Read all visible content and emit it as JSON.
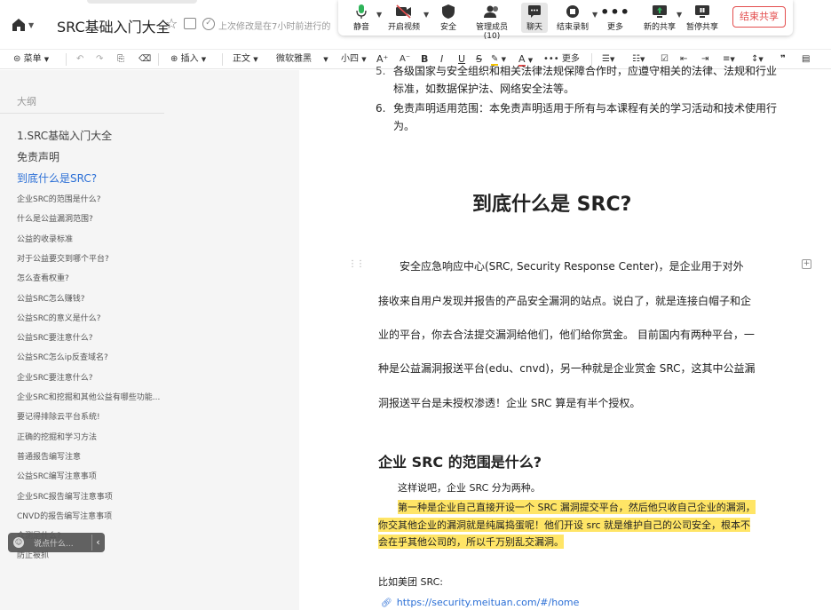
{
  "header": {
    "title": "SRC基础入门大全",
    "status": "上次修改是在7小时前进行的"
  },
  "meeting": {
    "mute": "静音",
    "video": "开启视频",
    "security": "安全",
    "members": "管理成员(10)",
    "chat": "聊天",
    "record": "结束录制",
    "more": "更多",
    "new_share": "新的共享",
    "pause_share": "暂停共享",
    "end_share": "结束共享"
  },
  "toolbar": {
    "menu": "菜单",
    "insert": "插入",
    "style": "正文",
    "font": "微软雅黑",
    "size": "小四",
    "more": "更多"
  },
  "sidebar": {
    "heading": "大纲",
    "items": [
      {
        "label": "1.SRC基础入门大全"
      },
      {
        "label": "免责声明"
      },
      {
        "label": "到底什么是SRC?"
      },
      {
        "label": "企业SRC的范围是什么?"
      },
      {
        "label": "什么是公益漏洞范围?"
      },
      {
        "label": "公益的收录标准"
      },
      {
        "label": "对于公益要交到哪个平台?"
      },
      {
        "label": "怎么查看权重?"
      },
      {
        "label": "公益SRC怎么赚钱?"
      },
      {
        "label": "公益SRC的意义是什么?"
      },
      {
        "label": "公益SRC要注意什么?"
      },
      {
        "label": "公益SRC怎么ip反查域名?"
      },
      {
        "label": "企业SRC要注意什么?"
      },
      {
        "label": "企业SRC和挖掘和其他公益有哪些功能..."
      },
      {
        "label": "要记得排除云平台系统!"
      },
      {
        "label": "正确的挖掘和学习方法"
      },
      {
        "label": "普通报告编写注意"
      },
      {
        "label": "公益SRC编写注意事项"
      },
      {
        "label": "企业SRC报告编写注意事项"
      },
      {
        "label": "CNVD的报告编写注意事项"
      },
      {
        "label": "众测是什么?"
      },
      {
        "label": "防止被抓"
      }
    ]
  },
  "chat_toast": {
    "placeholder": "说点什么..."
  },
  "document": {
    "item5": "各级国家与安全组织和相关法律法规保障合作时，应遵守相关的法律、法规和行业标准，如数据保护法、网络安全法等。",
    "item5_line1": "各级国家与安全组织和相关法律法规保障合作时，应遵守相关的法律、法规和行业",
    "item5_line2": "标准，如数据保护法、网络安全法等。",
    "item6_num": "6.",
    "item6_line1": "免责声明适用范围：本免责声明适用于所有与本课程有关的学习活动和技术使用行",
    "item6_line2": "为。",
    "heading1": "到底什么是 SRC?",
    "para_lines": [
      "安全应急响应中心(SRC, Security Response Center)，是企业用于对外",
      "接收来自用户发现并报告的产品安全漏洞的站点。说白了，就是连接白帽子和企",
      "业的平台，你去合法提交漏洞给他们，他们给你赏金。 目前国内有两种平台，一",
      "种是公益漏洞报送平台(edu、cnvd)，另一种就是企业赏金 SRC，这其中公益漏",
      "洞报送平台是未授权渗透！企业 SRC 算是有半个授权。"
    ],
    "heading2": "企业 SRC 的范围是什么?",
    "intro": "这样说吧，企业 SRC 分为两种。",
    "highlight_lines": [
      "第一种是企业自己直接开设一个 SRC 漏洞提交平台，然后他只收自己企业的漏洞，",
      "你交其他企业的漏洞就是纯属捣蛋呢！他们开设 src 就是维护自己的公司安全，根本不",
      "会在乎其他公司的，所以千万别乱交漏洞。"
    ],
    "example": "比如美团 SRC:",
    "link": "https://security.meituan.com/#/home"
  }
}
